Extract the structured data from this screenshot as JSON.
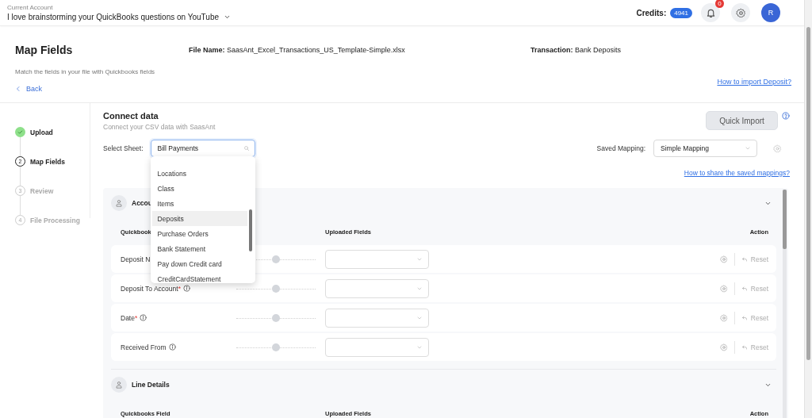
{
  "account": {
    "label": "Current Account",
    "name": "I love brainstorming your QuickBooks questions on YouTube"
  },
  "credits": {
    "label": "Credits:",
    "value": "4941"
  },
  "notifications": {
    "count": "0"
  },
  "user": {
    "initial": "R"
  },
  "header": {
    "title": "Map Fields",
    "subtitle": "Match the fields in your file with Quickbooks fields",
    "back": "Back",
    "file_label": "File Name:",
    "file_name": "SaasAnt_Excel_Transactions_US_Template-Simple.xlsx",
    "transaction_label": "Transaction:",
    "transaction": "Bank Deposits",
    "help_link": "How to import Deposit?"
  },
  "steps": [
    {
      "label": "Upload",
      "completed": true,
      "selected": false
    },
    {
      "number": "2",
      "label": "Map Fields",
      "completed": false,
      "selected": true
    },
    {
      "number": "3",
      "label": "Review",
      "completed": false,
      "selected": false
    },
    {
      "number": "4",
      "label": "File Processing",
      "completed": false,
      "selected": false
    }
  ],
  "connect": {
    "title": "Connect data",
    "subtitle": "Connect your CSV data with SaasAnt",
    "sheet_label": "Select Sheet:",
    "sheet_value": "Bill Payments",
    "quick_import": "Quick Import",
    "saved_label": "Saved Mapping:",
    "saved_value": "Simple Mapping",
    "share_link": "How to share the saved mappings?"
  },
  "sheet_options": [
    {
      "label": "Locations",
      "hovered": false
    },
    {
      "label": "Class",
      "hovered": false
    },
    {
      "label": "Items",
      "hovered": false
    },
    {
      "label": "Deposits",
      "hovered": true
    },
    {
      "label": "Purchase Orders",
      "hovered": false
    },
    {
      "label": "Bank Statement",
      "hovered": false
    },
    {
      "label": "Pay down Credit card",
      "hovered": false
    },
    {
      "label": "CreditCardStatement",
      "hovered": false
    }
  ],
  "sections": [
    {
      "title": "Accou",
      "expanded": true,
      "columns": [
        "Quickbook",
        "Uploaded Fields",
        "Action"
      ],
      "rows": [
        {
          "field": "Deposit N",
          "reset": "Reset"
        },
        {
          "field": "Deposit To Account",
          "required_mark": "*",
          "info": true,
          "reset": "Reset"
        },
        {
          "field": "Date",
          "required_mark": "*",
          "info": true,
          "reset": "Reset"
        },
        {
          "field": "Received From",
          "info": true,
          "reset": "Reset"
        }
      ]
    },
    {
      "title": "Line Details",
      "expanded": true,
      "columns": [
        "Quickbooks Field",
        "Uploaded Fields",
        "Action"
      ]
    }
  ]
}
